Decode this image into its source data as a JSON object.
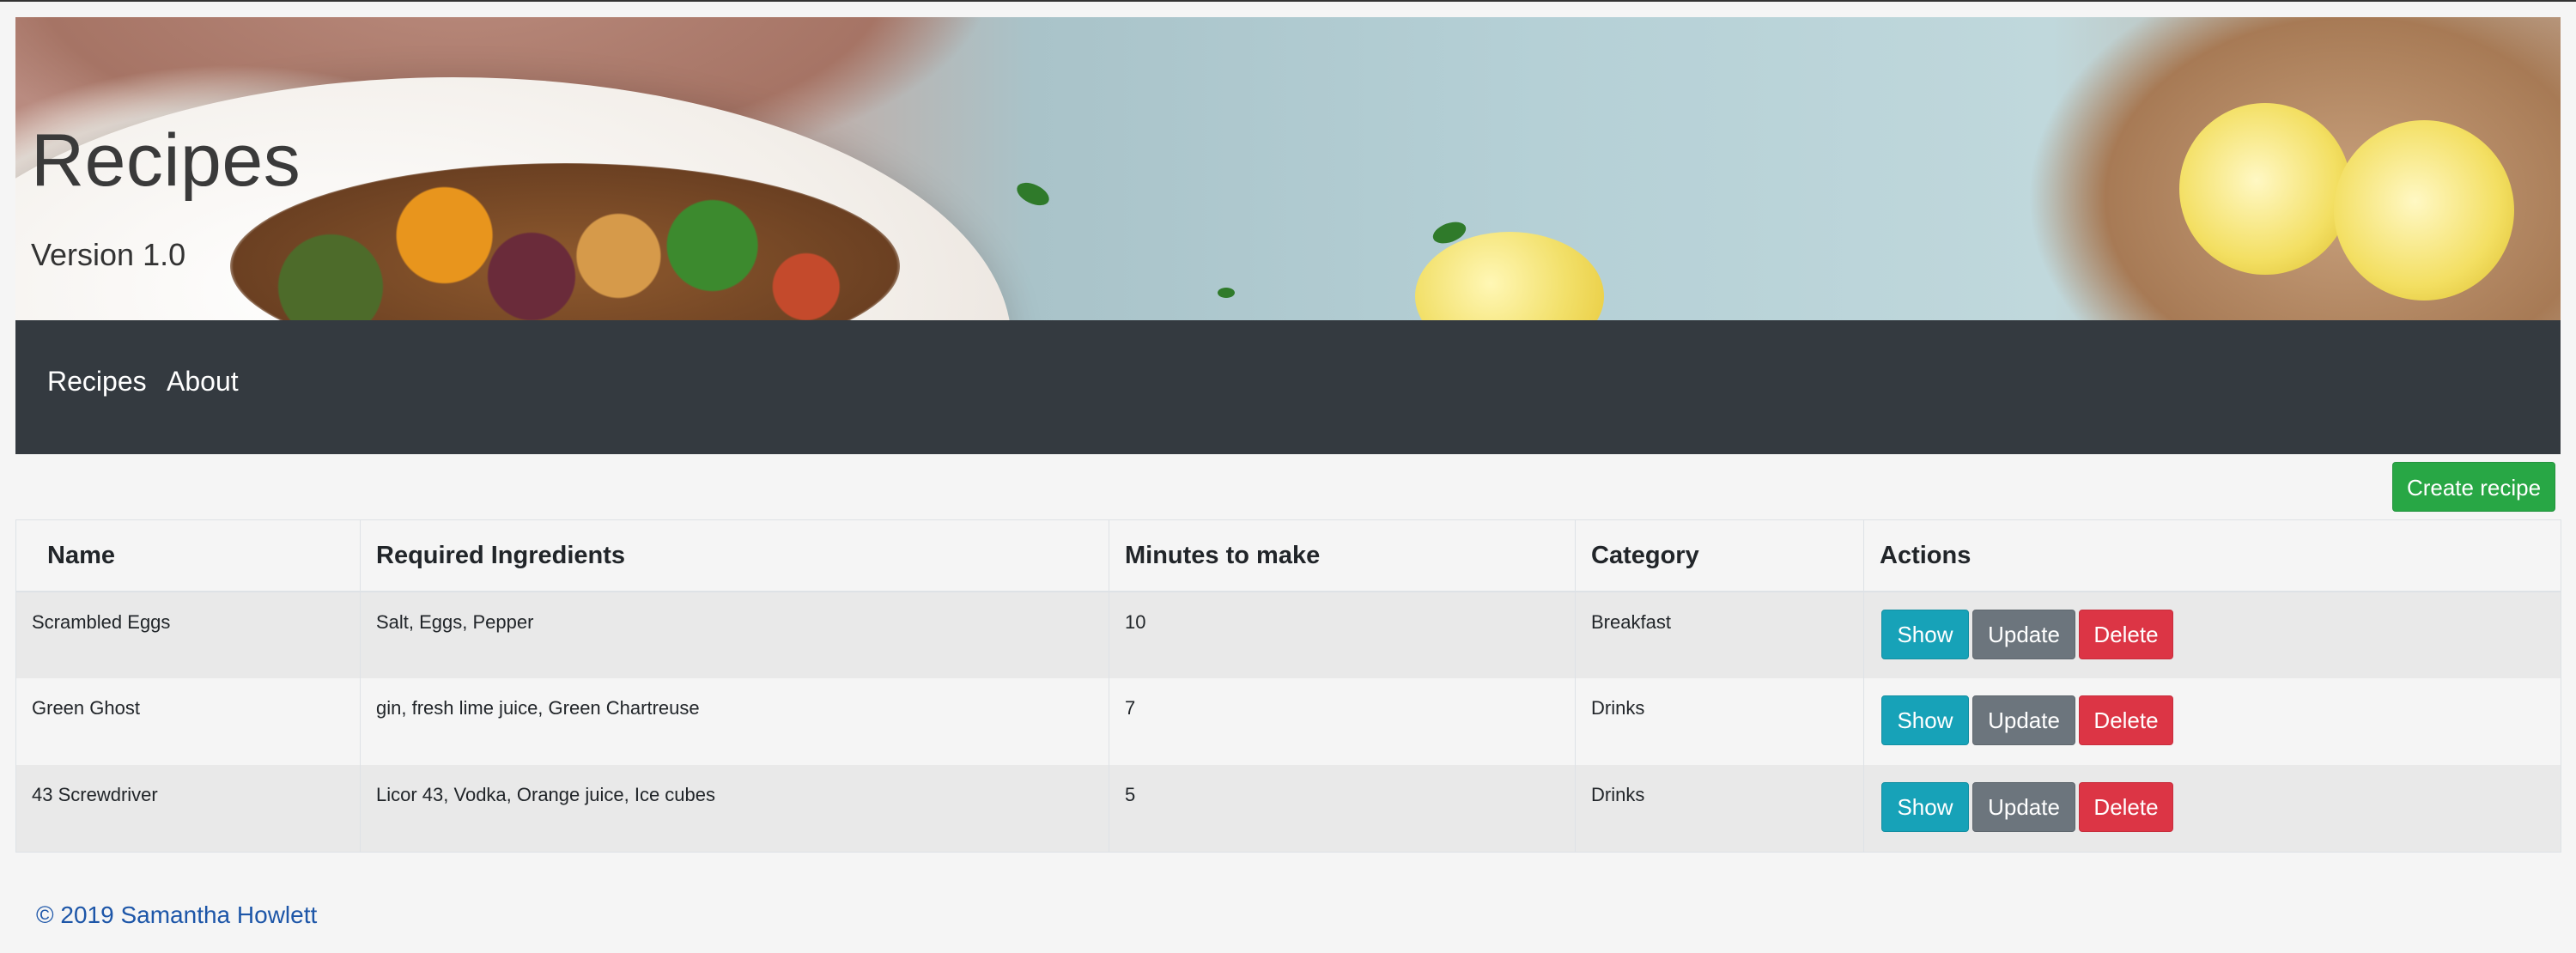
{
  "header": {
    "title": "Recipes",
    "version": "Version 1.0"
  },
  "nav": {
    "items": [
      {
        "label": "Recipes"
      },
      {
        "label": "About"
      }
    ]
  },
  "toolbar": {
    "create_label": "Create recipe"
  },
  "table": {
    "columns": [
      "Name",
      "Required Ingredients",
      "Minutes to make",
      "Category",
      "Actions"
    ],
    "rows": [
      {
        "name": "Scrambled Eggs",
        "ingredients": "Salt, Eggs, Pepper",
        "minutes": "10",
        "category": "Breakfast"
      },
      {
        "name": "Green Ghost",
        "ingredients": "gin, fresh lime juice, Green Chartreuse",
        "minutes": "7",
        "category": "Drinks"
      },
      {
        "name": "43 Screwdriver",
        "ingredients": "Licor 43, Vodka, Orange juice, Ice cubes",
        "minutes": "5",
        "category": "Drinks"
      }
    ],
    "actions": {
      "show_label": "Show",
      "update_label": "Update",
      "delete_label": "Delete"
    }
  },
  "footer": {
    "text": "© 2019 Samantha Howlett"
  },
  "colors": {
    "navbar": "#343a40",
    "create": "#28a745",
    "show": "#17a2b8",
    "update": "#6c757d",
    "delete": "#dc3545",
    "footer_link": "#1d56a8"
  }
}
